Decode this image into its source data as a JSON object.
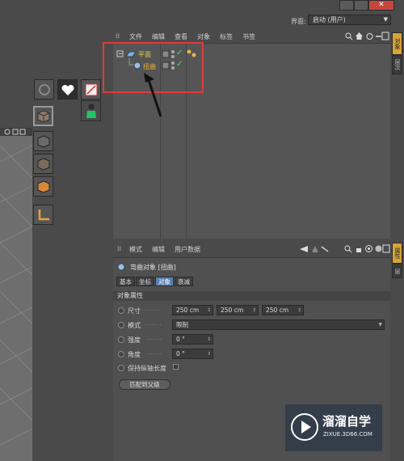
{
  "window": {
    "close_glyph": "✕",
    "layout_label": "界面:",
    "layout_value": "启动 (用户)"
  },
  "right_tabs": {
    "objects_tab": "对象",
    "layers_tab": "层次",
    "attr_tab": "属性",
    "layer_tab2": "层"
  },
  "object_manager": {
    "menus": [
      "文件",
      "编辑",
      "查看",
      "对象",
      "标签",
      "书签"
    ],
    "objects": [
      {
        "name": "平面",
        "check": "✓"
      },
      {
        "name": "扭曲",
        "check": "✓"
      }
    ]
  },
  "attribute_manager": {
    "menus": [
      "模式",
      "编辑",
      "用户数据"
    ],
    "object_title": "弯曲对象 [扭曲]",
    "tabs": [
      "基本",
      "坐标",
      "对象",
      "衰减"
    ],
    "active_tab": "对象",
    "section_title": "对象属性",
    "props": {
      "size_label": "尺寸",
      "size_values": [
        "250 cm",
        "250 cm",
        "250 cm"
      ],
      "mode_label": "模式",
      "mode_value": "限制",
      "strength_label": "强度",
      "strength_value": "0 °",
      "angle_label": "角度",
      "angle_value": "0 °",
      "keep_length_label": "保持纵轴长度"
    },
    "fit_button": "匹配到父级"
  },
  "watermark": {
    "brand": "溜溜自学",
    "url": "ZIXUE.3D66.COM"
  },
  "colors": {
    "highlight_box": "#e23a3a",
    "active_tab": "#5a7fb0",
    "close": "#c6463d"
  }
}
